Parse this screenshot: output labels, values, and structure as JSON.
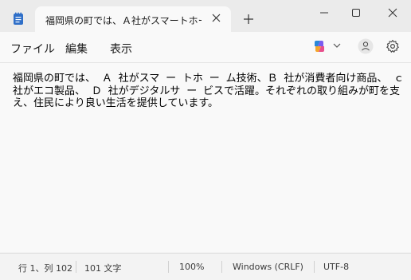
{
  "window": {
    "tab_title": "福岡県の町では、Ａ社がスマートホーム",
    "tab_close_icon": "close-icon",
    "new_tab_icon": "plus-icon",
    "controls": [
      "minimize-icon",
      "maximize-icon",
      "close-icon"
    ]
  },
  "menu": {
    "file": "ファイル",
    "edit": "編集",
    "view": "表示",
    "copilot_icon": "copilot-icon",
    "account_icon": "account-icon",
    "settings_icon": "gear-icon"
  },
  "editor": {
    "content": "福岡県の町では、 Ａ 社がスマ ー トホ ー ム技術、Ｂ 社が消費者向け商品、 ｃ 社がエコ製品、 Ｄ 社がデジタルサ ー ビスで活躍。それぞれの取り組みが町を支え、住民により良い生活を提供しています。"
  },
  "status": {
    "position": "行 1、列 102",
    "chars": "101 文字",
    "zoom": "100%",
    "line_ending": "Windows (CRLF)",
    "encoding": "UTF-8"
  },
  "colors": {
    "titlebar": "#ebebeb",
    "surface": "#f9f9f9",
    "statusbar": "#f3f3f3"
  }
}
